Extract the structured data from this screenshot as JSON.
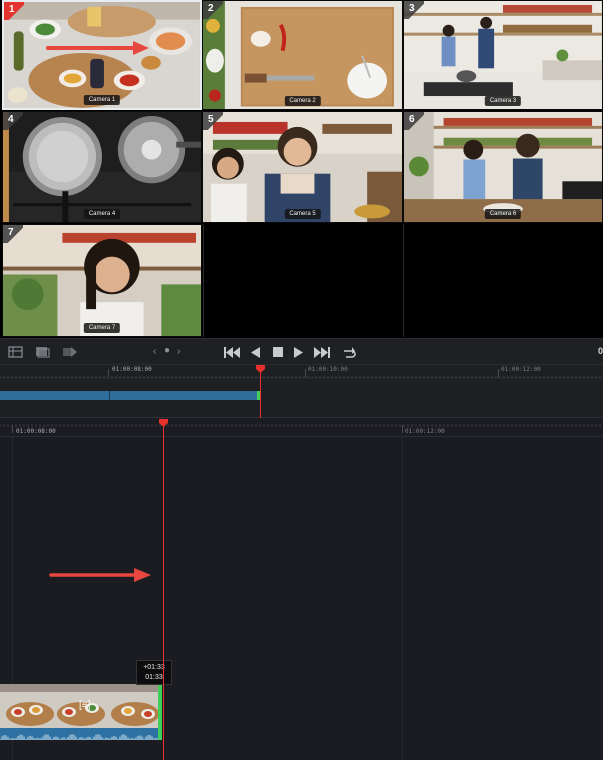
{
  "viewer": {
    "cameras": [
      {
        "num": "1",
        "label": "Camera 1",
        "active": true
      },
      {
        "num": "2",
        "label": "Camera 2",
        "active": false
      },
      {
        "num": "3",
        "label": "Camera 3",
        "active": false
      },
      {
        "num": "4",
        "label": "Camera 4",
        "active": false
      },
      {
        "num": "5",
        "label": "Camera 5",
        "active": false
      },
      {
        "num": "6",
        "label": "Camera 6",
        "active": false
      },
      {
        "num": "7",
        "label": "Camera 7",
        "active": false
      }
    ]
  },
  "transport": {
    "right_timecode": "0"
  },
  "upper_timeline": {
    "ruler_labels": [
      "01:00:08:00",
      "01:00:10:00",
      "01:00:12:00"
    ]
  },
  "lower_timeline": {
    "ruler_labels": [
      "01:00:08:00",
      "01:00:12:00"
    ],
    "tooltip_line1": "+01:33",
    "tooltip_line2": "01:33"
  },
  "colors": {
    "playhead": "#e8302e",
    "clip_video": "#2f6e9c",
    "clip_end_marker": "#3fcf5a",
    "active_camera_badge": "#e3342f",
    "annotation_arrow": "#e8473f"
  },
  "icons": {
    "tool_1": "multicam-viewer-icon",
    "tool_2": "source-viewer-icon",
    "tool_3": "edit-overlay-icon",
    "prev": "chevron-left-icon",
    "dot": "dot-icon",
    "next": "chevron-right-icon",
    "go_start": "skip-to-start-icon",
    "step_back": "play-reverse-icon",
    "stop": "stop-icon",
    "play": "play-icon",
    "go_end": "skip-to-end-icon",
    "loop": "loop-icon"
  }
}
